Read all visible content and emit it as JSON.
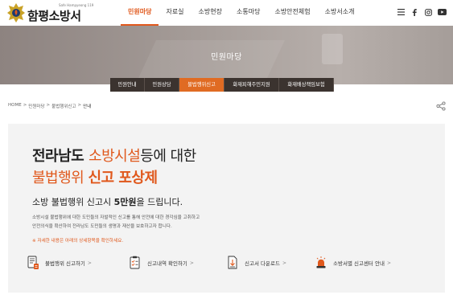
{
  "header": {
    "logo_small": "Safe Hampyeong 119",
    "logo_text": "함평소방서",
    "nav": [
      "민원마당",
      "자료실",
      "소방현장",
      "소통마당",
      "소방안전체험",
      "소방서소개"
    ],
    "nav_active_index": 0,
    "icons": [
      "menu-icon",
      "facebook-icon",
      "instagram-icon",
      "youtube-icon"
    ]
  },
  "hero": {
    "title": "민원마당"
  },
  "subtabs": {
    "items": [
      "민원안내",
      "민원상담",
      "불법행위신고",
      "화재피해주민지원",
      "화재배상책임보험"
    ],
    "active_index": 2
  },
  "breadcrumb": {
    "items": [
      "HOME",
      ">",
      "민원마당",
      ">",
      "불법행위신고",
      ">"
    ],
    "current": "안내"
  },
  "main": {
    "headline1_a": "전라남도 ",
    "headline1_b": "소방시설",
    "headline1_c": "등에 대한",
    "headline2_a": "불법행위 ",
    "headline2_b": "신고 포상제",
    "subhead_a": "소방 불법행위 신고시 ",
    "subhead_b": "5만원",
    "subhead_c": "을 드립니다.",
    "desc_line1": "소방시설 불법행위에 대한 도민들의 자발적인 신고를 통해 안전에 대한 경각심을 고취하고",
    "desc_line2": "안전의식을 확산하여 전라남도 도민들의 생명과 재산을 보호하고자 합니다.",
    "notice": "※ 자세한 내용은 아래의 상세항목을 확인하세요.",
    "links": [
      {
        "label": "불법행위 신고하기",
        "icon": "report-icon"
      },
      {
        "label": "신고내역 확인하기",
        "icon": "checklist-icon"
      },
      {
        "label": "신고서 다운로드",
        "icon": "download-icon"
      },
      {
        "label": "소방서별 신고센터 안내",
        "icon": "siren-icon"
      }
    ],
    "arrow": ">"
  },
  "colors": {
    "accent": "#e0581c",
    "tab_dark": "#3b332f",
    "tab_active": "#e06b23",
    "card_bg": "#f3f3f3"
  }
}
